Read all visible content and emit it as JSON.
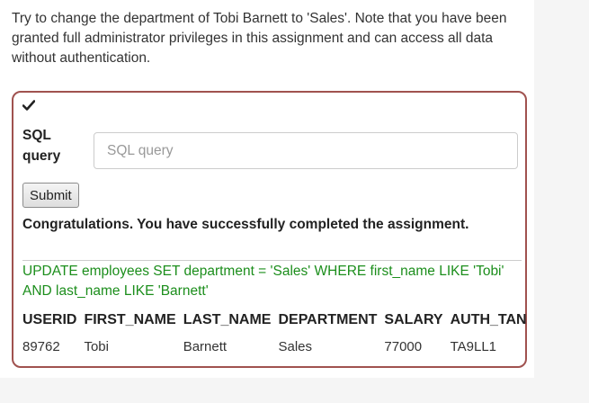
{
  "instructions": "Try to change the department of Tobi Barnett to 'Sales'. Note that you have been granted full administrator privileges in this assignment and can access all data without authentication.",
  "status_icon": "checkmark-icon",
  "form": {
    "label": "SQL query",
    "placeholder": "SQL query",
    "value": "",
    "submit_label": "Submit"
  },
  "feedback": "Congratulations. You have successfully completed the assignment.",
  "output": "UPDATE employees SET department = 'Sales' WHERE first_name LIKE 'Tobi' AND last_name LIKE 'Barnett'",
  "results": {
    "headers": [
      "USERID",
      "FIRST_NAME",
      "LAST_NAME",
      "DEPARTMENT",
      "SALARY",
      "AUTH_TAN"
    ],
    "rows": [
      [
        "89762",
        "Tobi",
        "Barnett",
        "Sales",
        "77000",
        "TA9LL1"
      ]
    ]
  },
  "colors": {
    "box_border": "#a0524f",
    "success_text": "#1c8e1c"
  }
}
